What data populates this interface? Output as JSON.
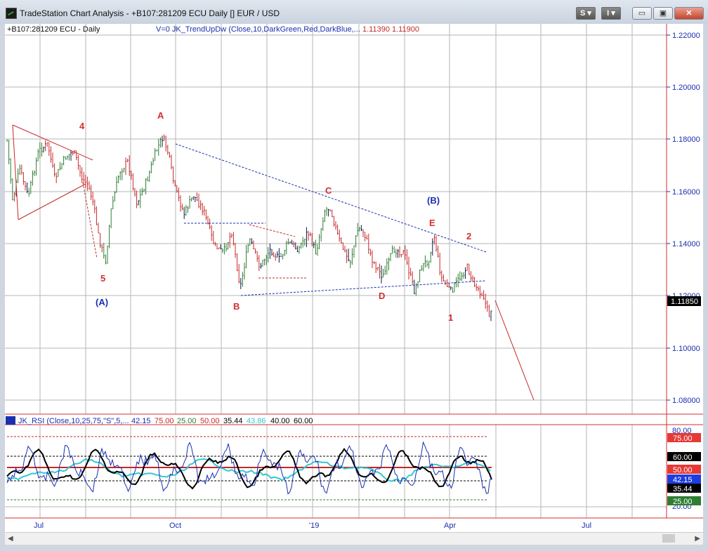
{
  "window": {
    "title": "TradeStation Chart Analysis - +B107:281209 ECU Daily [] EUR / USD",
    "btn_s": "S ▾",
    "btn_i": "I ▾",
    "minimize": "▭",
    "maximize": "▣",
    "close": "✕"
  },
  "price_pane": {
    "symbol_label": "+B107:281209 ECU - Daily",
    "indicator_label": "V=0  JK_TrendUpDw (Close,10,DarkGreen,Red,DarkBlue,...",
    "indicator_values": "1.11390  1.11900",
    "y_ticks": [
      "1.22000",
      "1.20000",
      "1.18000",
      "1.16000",
      "1.14000",
      "1.12000",
      "1.10000",
      "1.08000"
    ],
    "last_price": "1.11850",
    "wave_labels": {
      "w4": "4",
      "w5": "5",
      "wA_big": "(A)",
      "wA": "A",
      "wB": "B",
      "wC": "C",
      "wD": "D",
      "wE": "E",
      "wB_big": "(B)",
      "w1": "1",
      "w2": "2"
    }
  },
  "rsi_pane": {
    "label": "JK_RSI (Close,10,25,75,\"S\",5,...",
    "values": [
      "42.15",
      "75.00",
      "25.00",
      "50.00",
      "35.44",
      "43.86",
      "40.00",
      "60.00"
    ],
    "y_ticks": [
      "80.00",
      "20.00"
    ],
    "badges": [
      "75.00",
      "60.00",
      "50.00",
      "42.15",
      "35.44",
      "25.00"
    ]
  },
  "x_axis": [
    "Jul",
    "Oct",
    "'19",
    "Apr",
    "Jul"
  ],
  "colors": {
    "up_bar": "#2e7d32",
    "down_bar": "#c62828",
    "neutral_bar": "#0a1a4a",
    "wave_red": "#d32f2f",
    "wave_blue": "#1a2fb0",
    "grid": "#b0b0b0",
    "axis_text": "#1a2fb0"
  }
}
